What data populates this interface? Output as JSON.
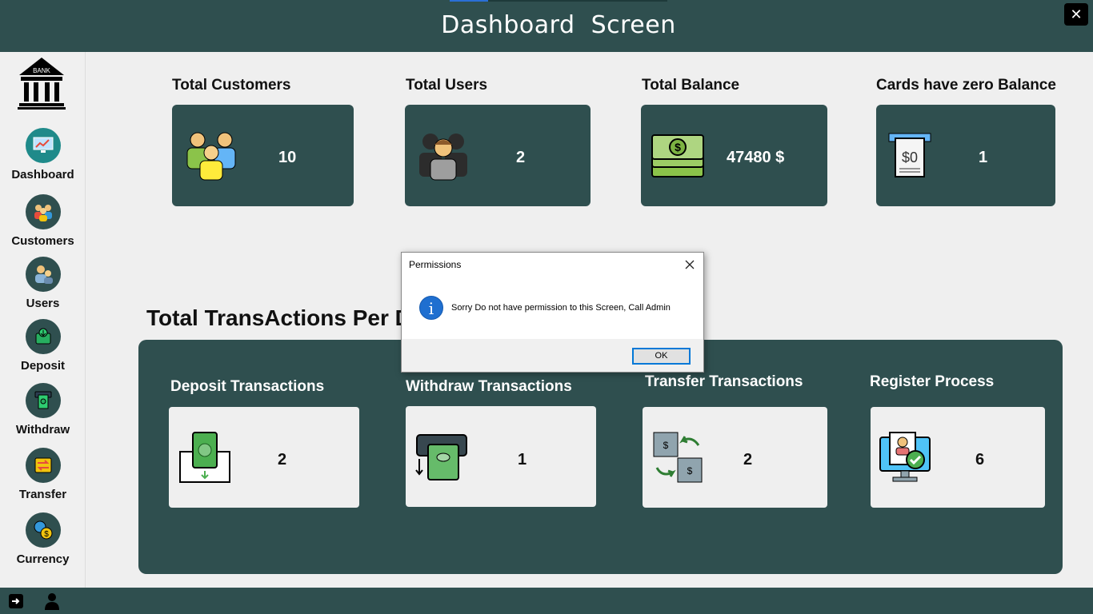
{
  "window": {
    "title": "Dashboard  Screen",
    "close_symbol": "✕"
  },
  "sidebar": {
    "logo_text": "BANK",
    "items": [
      {
        "label": "Dashboard",
        "icon": "dashboard-icon",
        "active": true
      },
      {
        "label": "Customers",
        "icon": "customers-icon"
      },
      {
        "label": "Users",
        "icon": "users-icon"
      },
      {
        "label": "Deposit",
        "icon": "deposit-icon"
      },
      {
        "label": "Withdraw",
        "icon": "withdraw-icon"
      },
      {
        "label": "Transfer",
        "icon": "transfer-icon"
      },
      {
        "label": "Currency",
        "icon": "currency-icon"
      }
    ]
  },
  "stats": [
    {
      "label": "Total Customers",
      "value": "10",
      "icon": "customers-group-icon"
    },
    {
      "label": "Total Users",
      "value": "2",
      "icon": "users-group-icon"
    },
    {
      "label": "Total Balance",
      "value": "47480 $",
      "icon": "money-stack-icon"
    },
    {
      "label": "Cards have zero Balance",
      "value": "1",
      "icon": "zero-balance-receipt-icon"
    }
  ],
  "transactions": {
    "title": "Total TransActions Per Day",
    "cards": [
      {
        "label": "Deposit Transactions",
        "value": "2",
        "icon": "deposit-cash-icon"
      },
      {
        "label": "Withdraw Transactions",
        "value": "1",
        "icon": "withdraw-cash-icon"
      },
      {
        "label": "Transfer Transactions",
        "value": "2",
        "icon": "transfer-cash-icon"
      },
      {
        "label": "Register Process",
        "value": "6",
        "icon": "register-profile-icon"
      }
    ]
  },
  "dialog": {
    "title": "Permissions",
    "message": "Sorry Do not have permission to this Screen, Call Admin",
    "ok_label": "OK",
    "info_symbol": "i"
  },
  "colors": {
    "primary": "#2f4f4f",
    "accent": "#1f8a8a",
    "dialog_button_border": "#0078d7"
  }
}
